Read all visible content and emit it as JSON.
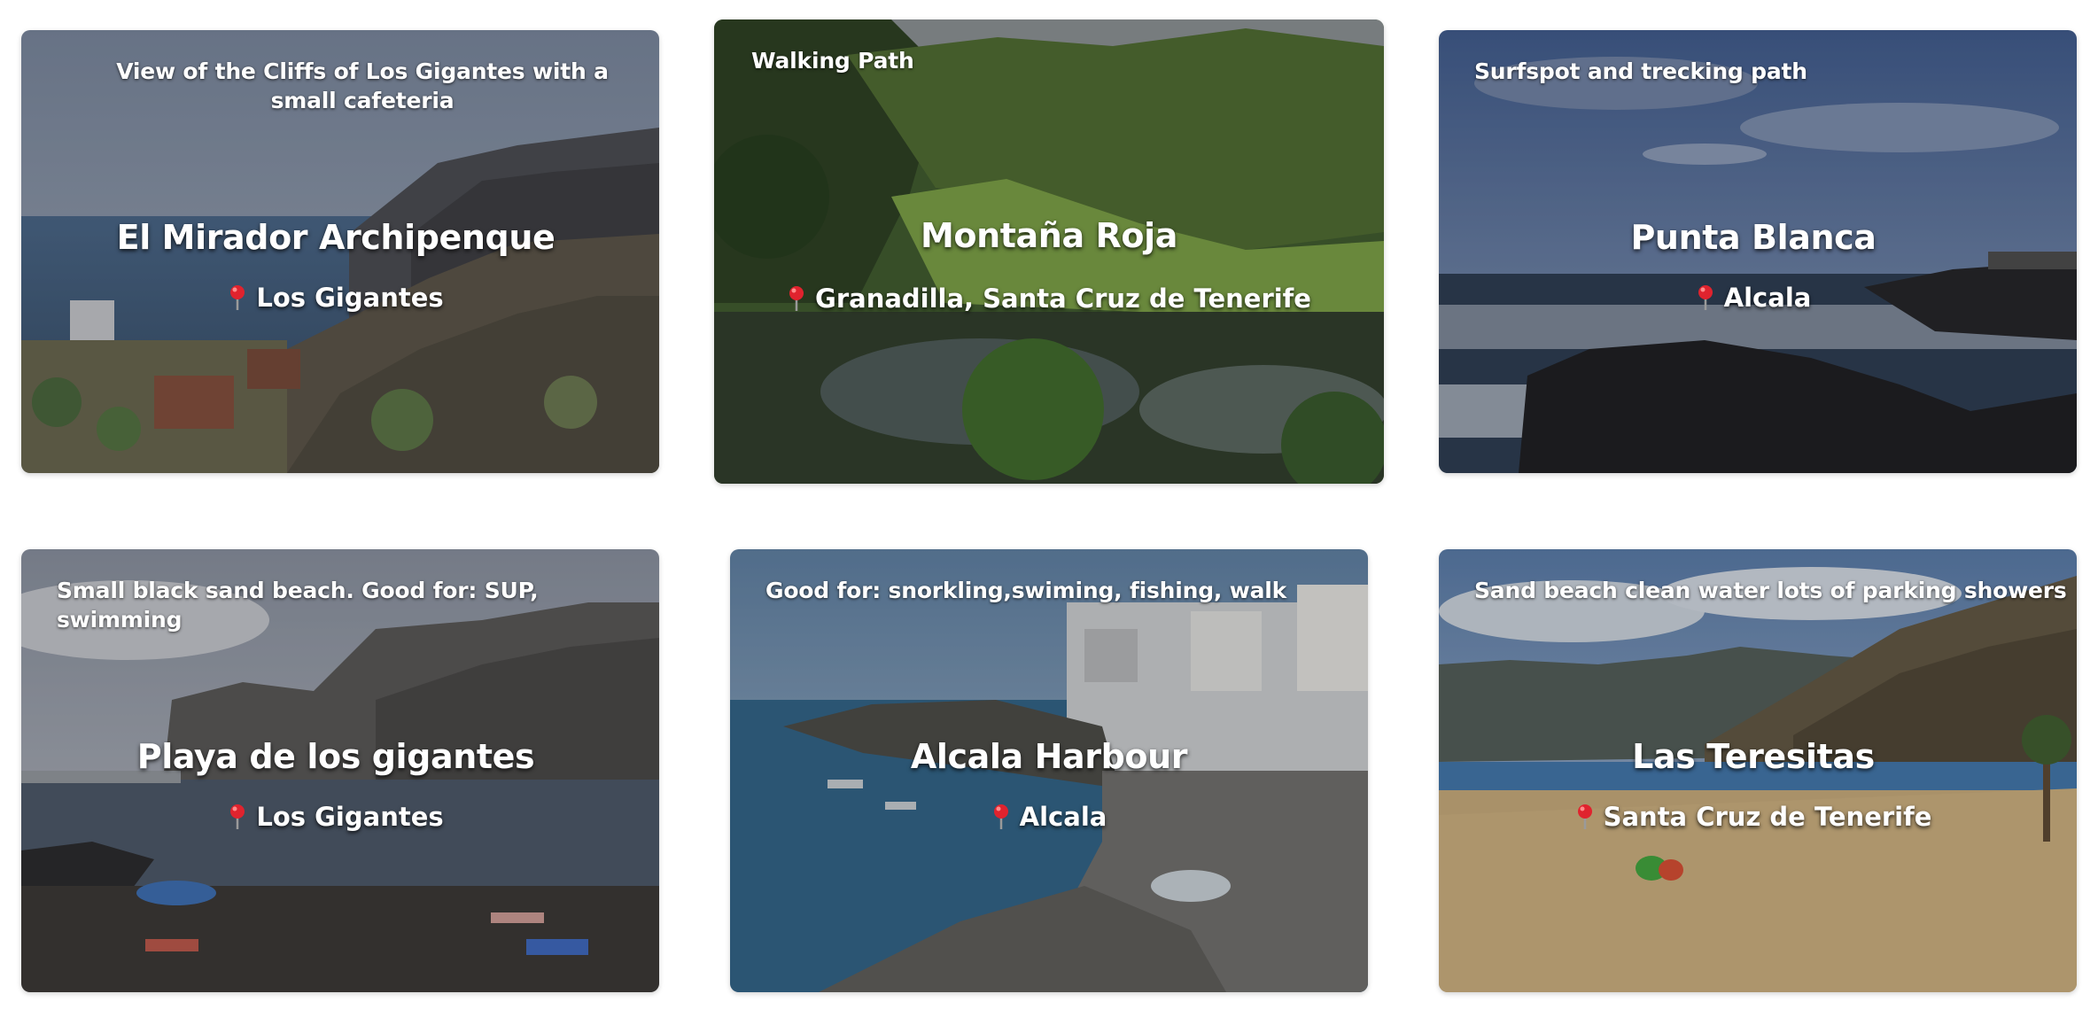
{
  "cards": [
    {
      "title": "El Mirador Archipenque",
      "location": "Los Gigantes",
      "description": "View of the Cliffs of Los Gigantes with a small cafeteria"
    },
    {
      "title": "Montaña Roja",
      "location": "Granadilla, Santa Cruz de Tenerife",
      "description": "Walking Path"
    },
    {
      "title": "Punta Blanca",
      "location": "Alcala",
      "description": "Surfspot and trecking path"
    },
    {
      "title": "Playa de los gigantes",
      "location": "Los Gigantes",
      "description": "Small black sand beach. Good for: SUP, swimming"
    },
    {
      "title": "Alcala Harbour",
      "location": "Alcala",
      "description": "Good for: snorkling,swiming, fishing, walk"
    },
    {
      "title": "Las Teresitas",
      "location": "Santa Cruz de Tenerife",
      "description": "Sand beach clean water lots of parking showers"
    }
  ],
  "icons": {
    "location": "pin-icon"
  },
  "colors": {
    "pin": "#e0232e",
    "text": "#ffffff"
  }
}
